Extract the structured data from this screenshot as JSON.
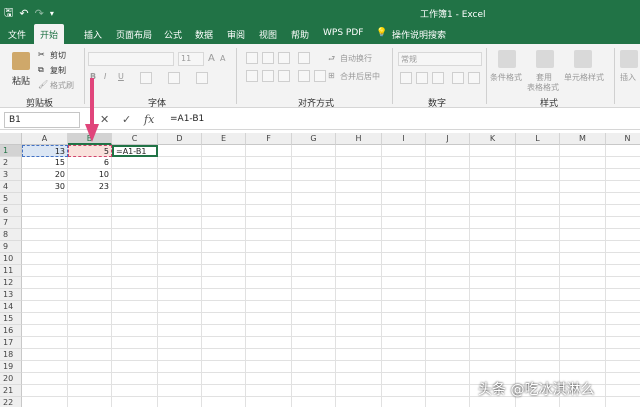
{
  "window": {
    "title": "工作簿1 - Excel",
    "qat_icons": [
      "save-icon",
      "undo-icon",
      "redo-icon",
      "customize-icon"
    ],
    "accent_color": "#217346"
  },
  "tabs": [
    "文件",
    "开始",
    "插入",
    "页面布局",
    "公式",
    "数据",
    "审阅",
    "视图",
    "帮助",
    "WPS PDF",
    "操作说明搜索"
  ],
  "active_tab": "开始",
  "ribbon": {
    "clipboard": {
      "paste": "粘贴",
      "cut": "剪切",
      "copy": "复制",
      "format_painter": "格式刷",
      "label": "剪贴板"
    },
    "font": {
      "size": "11",
      "label": "字体"
    },
    "alignment": {
      "wrap": "自动换行",
      "merge": "合并后居中",
      "label": "对齐方式"
    },
    "number": {
      "format": "常规",
      "label": "数字"
    },
    "styles": {
      "conditional": "条件格式",
      "table_line1": "套用",
      "table_line2": "表格格式",
      "cell_styles": "单元格样式",
      "label": "样式"
    },
    "cells": {
      "insert": "插入"
    }
  },
  "formula_bar": {
    "name_box": "B1",
    "cancel": "✕",
    "enter": "✓",
    "fx": "fx",
    "formula": "=A1-B1"
  },
  "sheet": {
    "columns": [
      "A",
      "B",
      "C",
      "D",
      "E",
      "F",
      "G",
      "H",
      "I",
      "J",
      "K",
      "L",
      "M",
      "N"
    ],
    "rows": [
      "1",
      "2",
      "3",
      "4",
      "5",
      "6",
      "7",
      "8",
      "9",
      "10",
      "11",
      "12",
      "13",
      "14",
      "15",
      "16",
      "17",
      "18",
      "19",
      "20",
      "21",
      "22"
    ],
    "cells": {
      "A1": "13",
      "B1": "5",
      "C1": "=A1-B1",
      "A2": "15",
      "B2": "6",
      "A3": "20",
      "B3": "10",
      "A4": "30",
      "B4": "23"
    },
    "arrow_color": "#e0457b"
  },
  "watermark": "头条 @吃冰淇淋么"
}
